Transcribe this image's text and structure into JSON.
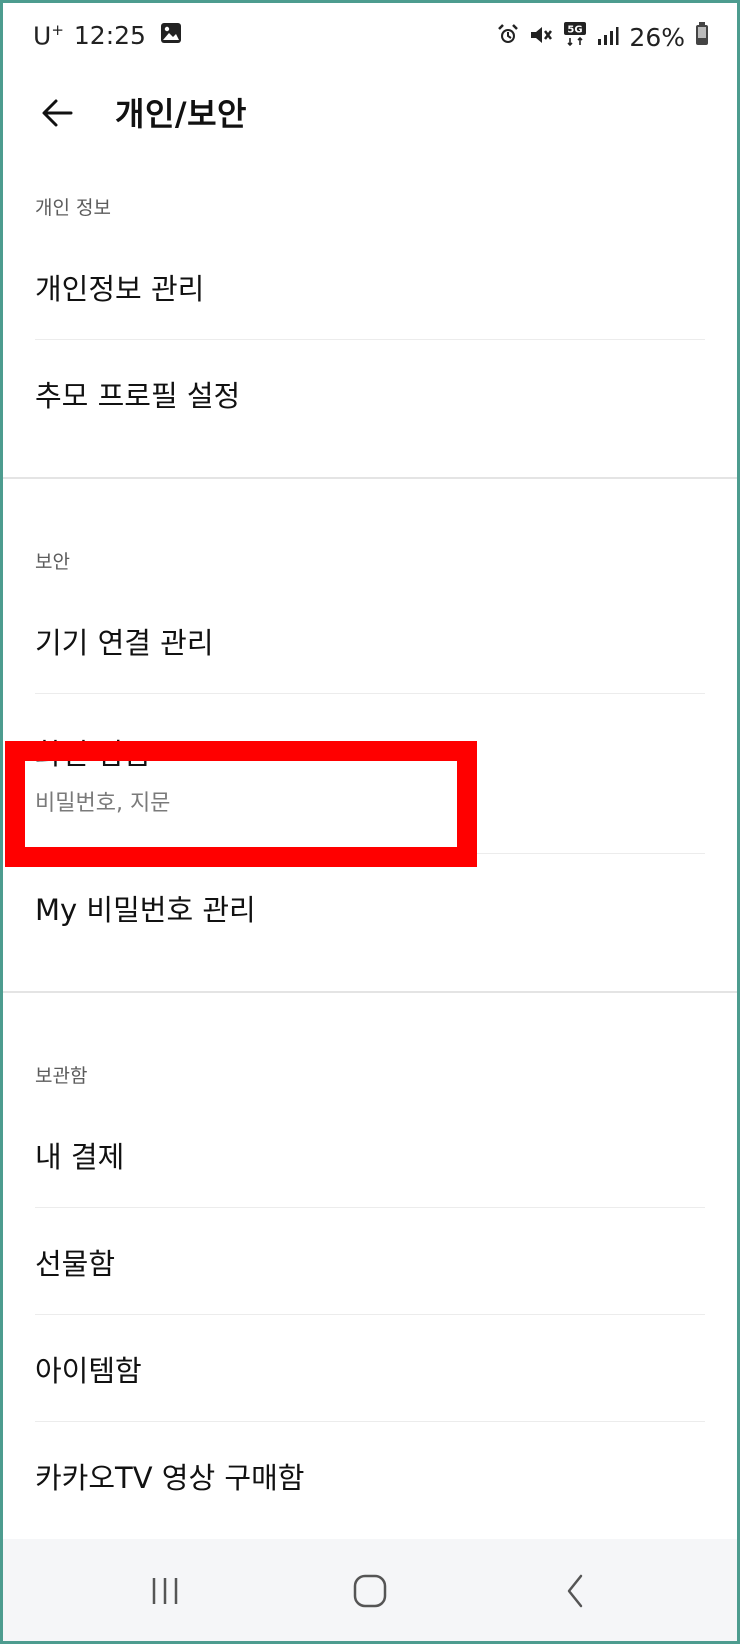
{
  "status_bar": {
    "carrier": "U",
    "carrier_sup": "+",
    "time": "12:25",
    "battery": "26%",
    "network": "5G"
  },
  "header": {
    "title": "개인/보안"
  },
  "sections": {
    "personal": {
      "header": "개인 정보",
      "items": [
        {
          "label": "개인정보 관리"
        },
        {
          "label": "추모 프로필 설정"
        }
      ]
    },
    "security": {
      "header": "보안",
      "items": [
        {
          "label": "기기 연결 관리"
        },
        {
          "label": "화면 잠금",
          "sub": "비밀번호, 지문"
        },
        {
          "label": "My 비밀번호 관리"
        }
      ]
    },
    "storage": {
      "header": "보관함",
      "items": [
        {
          "label": "내 결제"
        },
        {
          "label": "선물함"
        },
        {
          "label": "아이템함"
        },
        {
          "label": "카카오TV 영상 구매함"
        }
      ]
    }
  },
  "colors": {
    "highlight": "#ff0000",
    "frame": "#4d9c8f",
    "navbar_bg": "#f5f6f8"
  },
  "icons": {
    "back": "arrow-left-icon",
    "nav_recent": "recent-apps-icon",
    "nav_home": "home-icon",
    "nav_back": "chevron-left-icon"
  }
}
